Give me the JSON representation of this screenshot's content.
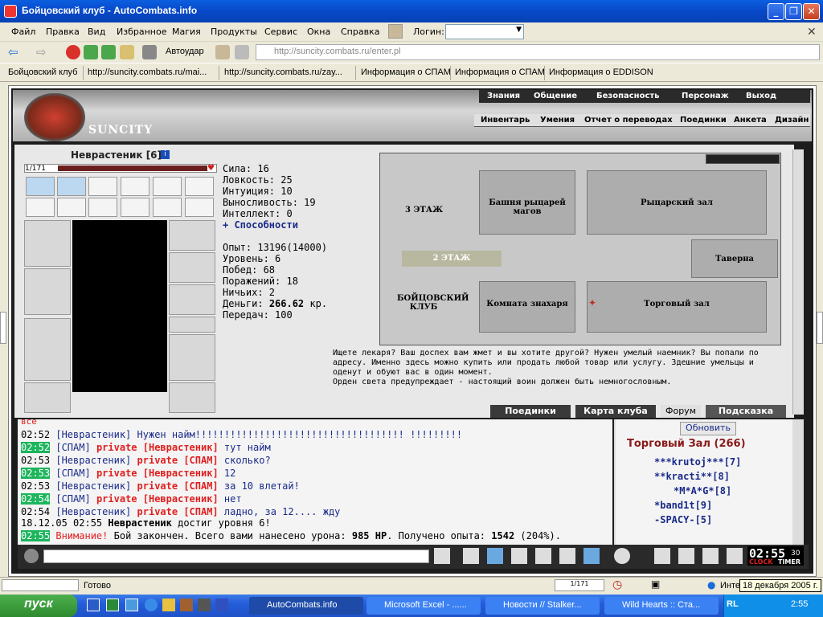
{
  "window": {
    "title": "Бойцовский клуб - AutoCombats.info"
  },
  "menu": [
    "Файл",
    "Правка",
    "Вид",
    "Избранное",
    "Магия",
    "Продукты",
    "Сервис",
    "Окна",
    "Справка"
  ],
  "login_label": "Логин:",
  "toolbar": {
    "autohit": "Автоудар"
  },
  "address": "http://suncity.combats.ru/enter.pl",
  "bookmarks": [
    "Бойцовский клуб",
    "http://suncity.combats.ru/mai...",
    "http://suncity.combats.ru/zay...",
    "Информация о СПАМ",
    "Информация о СПАМ",
    "Информация о EDDISON"
  ],
  "top_tabs": [
    "Знания",
    "Общение",
    "Безопасность",
    "Персонаж",
    "Выход"
  ],
  "sub_tabs": [
    "Инвентарь",
    "Умения",
    "Отчет о переводах",
    "Поединки",
    "Анкета",
    "Дизайн"
  ],
  "logo_text": "SUNCITY",
  "character": {
    "name": "Неврастеник [6]",
    "hp": "1/171"
  },
  "stats": [
    "Сила: 16",
    "Ловкость: 25",
    "Интуиция: 10",
    "Выносливость: 19",
    "Интеллект: 0"
  ],
  "abilities": "+ Способности",
  "stats2": [
    "Опыт: 13196(14000)",
    "Уровень: 6",
    "Побед: 68",
    "Поражений: 18",
    "Ничьих: 2"
  ],
  "money_label": "Деньги:",
  "money_value": "266.62",
  "money_unit": "кр.",
  "transfers": "Передач: 100",
  "map_labels": {
    "floor3": "3 ЭТАЖ",
    "floor2": "2 ЭТАЖ",
    "club": "БОЙЦОВСКИЙ КЛУБ",
    "tower": "Башня рыцарей магов",
    "knight_hall": "Рыцарский зал",
    "tavern": "Таверна",
    "healer": "Комната знахаря",
    "trade_hall": "Торговый зал"
  },
  "description": "Ищете лекаря? Ваш доспех вам жмет и вы хотите другой? Нужен умелый наемник? Вы попали по адресу. Именно здесь можно купить или продать любой товар или услугу. Здешние умельцы и оденут и обуют вас в один момент.",
  "description2": "Орден света предупреждает - настоящий воин должен быть немногословным.",
  "map_buttons": [
    "Поединки",
    "Карта клуба",
    "Форум",
    "Подсказка"
  ],
  "chat_top": "все",
  "chat": [
    {
      "ts": "02:52",
      "g": false,
      "nick": "[Неврастеник]",
      "priv": "",
      "msg": "Нужен найм!!!!!!!!!!!!!!!!!!!!!!!!!!!!!!!!!!!! !!!!!!!!!"
    },
    {
      "ts": "02:52",
      "g": true,
      "nick": "[СПАМ]",
      "priv": "private [Неврастеник]",
      "msg": "тут найм"
    },
    {
      "ts": "02:53",
      "g": false,
      "nick": "[Неврастеник]",
      "priv": "private [СПАМ]",
      "msg": "сколько?"
    },
    {
      "ts": "02:53",
      "g": true,
      "nick": "[СПАМ]",
      "priv": "private [Неврастеник]",
      "msg": "12"
    },
    {
      "ts": "02:53",
      "g": false,
      "nick": "[Неврастеник]",
      "priv": "private [СПАМ]",
      "msg": "за 10 влетай!"
    },
    {
      "ts": "02:54",
      "g": true,
      "nick": "[СПАМ]",
      "priv": "private [Неврастеник]",
      "msg": "нет"
    },
    {
      "ts": "02:54",
      "g": false,
      "nick": "[Неврастеник]",
      "priv": "private [СПАМ]",
      "msg": "ладно, за 12.... жду"
    }
  ],
  "level_up": {
    "ts": "18.12.05 02:55",
    "text1": "Неврастеник",
    "text2": "достиг уровня 6!"
  },
  "battle": {
    "ts": "02:55",
    "warn": "Внимание!",
    "t1": "Бой закончен. Всего вами нанесено урона:",
    "dmg": "985 HP",
    "t2": ". Получено опыта:",
    "exp": "1542",
    "pct": "(204%)."
  },
  "room": {
    "refresh": "Обновить",
    "title": "Торговый Зал (266)",
    "users": [
      "***krutoj***[7]",
      "**kracti**[8]",
      "*M*A*G*[8]",
      "*band1t[9]",
      "-SPACY-[5]"
    ]
  },
  "clock": {
    "time": "02:55",
    "sec": "30",
    "clock_label": "CLOCK",
    "timer_label": "TIMER"
  },
  "status": {
    "text": "Готово",
    "hp": "1/171",
    "zone": "Инте",
    "date": "18 декабря 2005 г."
  },
  "taskbar": {
    "start": "пуск",
    "items": [
      "AutoCombats.info",
      "Microsoft Excel - ......",
      "Новости // Stalker...",
      "Wild Hearts :: Ста..."
    ],
    "lang": "RL",
    "time": "2:55"
  }
}
